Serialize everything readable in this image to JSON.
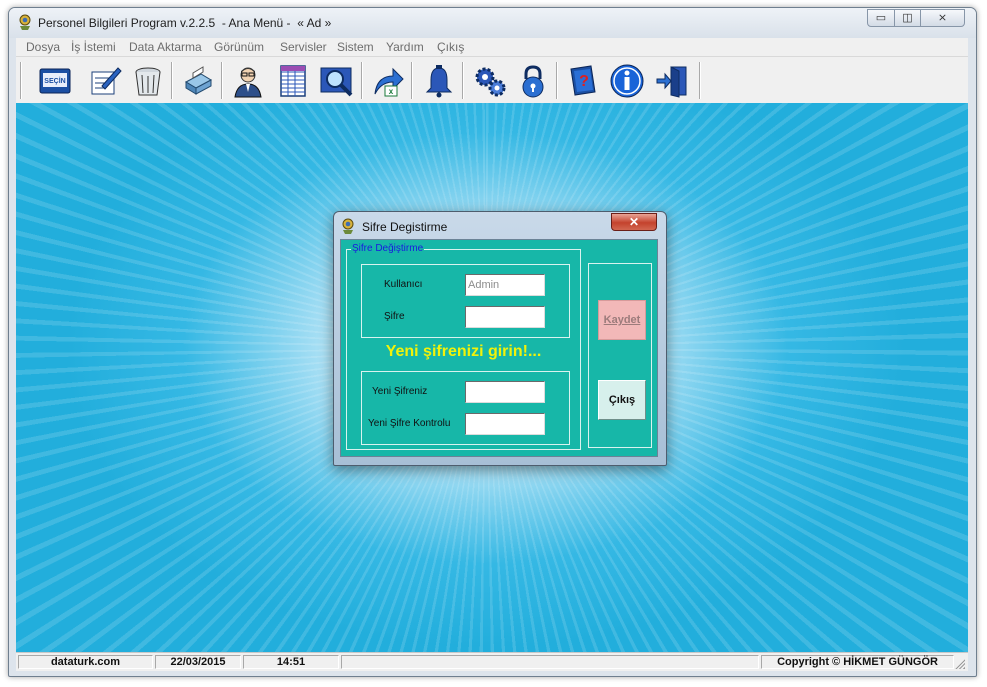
{
  "window": {
    "title": "Personel Bilgileri Program v.2.2.5  - Ana Menü -  « Ad »",
    "controls": {
      "minimize": "▭",
      "maximize": "◫",
      "close": "⨯"
    }
  },
  "menu": {
    "items": [
      "Dosya",
      "İş İstemi",
      "Data Aktarma",
      "Görünüm",
      "Servisler",
      "Sistem",
      "Yardım",
      "Çıkış"
    ]
  },
  "toolbar": {
    "buttons": [
      {
        "icon": "secin-book-icon",
        "text": "SEÇİN"
      },
      {
        "icon": "edit-document-icon"
      },
      {
        "icon": "trash-bin-icon"
      },
      {
        "icon": "printer-icon"
      },
      {
        "icon": "user-profile-icon"
      },
      {
        "icon": "spreadsheet-icon"
      },
      {
        "icon": "search-magnifier-icon"
      },
      {
        "icon": "export-arrow-icon"
      },
      {
        "icon": "bell-icon"
      },
      {
        "icon": "settings-gears-icon"
      },
      {
        "icon": "padlock-icon"
      },
      {
        "icon": "help-book-icon"
      },
      {
        "icon": "info-icon"
      },
      {
        "icon": "exit-door-icon"
      }
    ]
  },
  "dialog": {
    "title": "Sifre Degistirme",
    "close_label": "✕",
    "group_title": "Şifre Değiştirme",
    "user_label": "Kullanıcı",
    "user_value": "Admin",
    "password_label": "Şifre",
    "password_value": "",
    "prompt": "Yeni şifrenizi girin!...",
    "new_password_label": "Yeni Şifreniz",
    "new_password_value": "",
    "confirm_label": "Yeni Şifre Kontrolu",
    "confirm_value": "",
    "save_button": "Kaydet",
    "exit_button": "Çıkış"
  },
  "statusbar": {
    "site": "dataturk.com",
    "date": "22/03/2015",
    "time": "14:51",
    "copyright": "Copyright © HİKMET GÜNGÖR"
  },
  "colors": {
    "desktop": "#22aedc",
    "dialog_body": "#17b7a8",
    "prompt_text": "#f2f20a",
    "group_label": "#1a1adf"
  }
}
